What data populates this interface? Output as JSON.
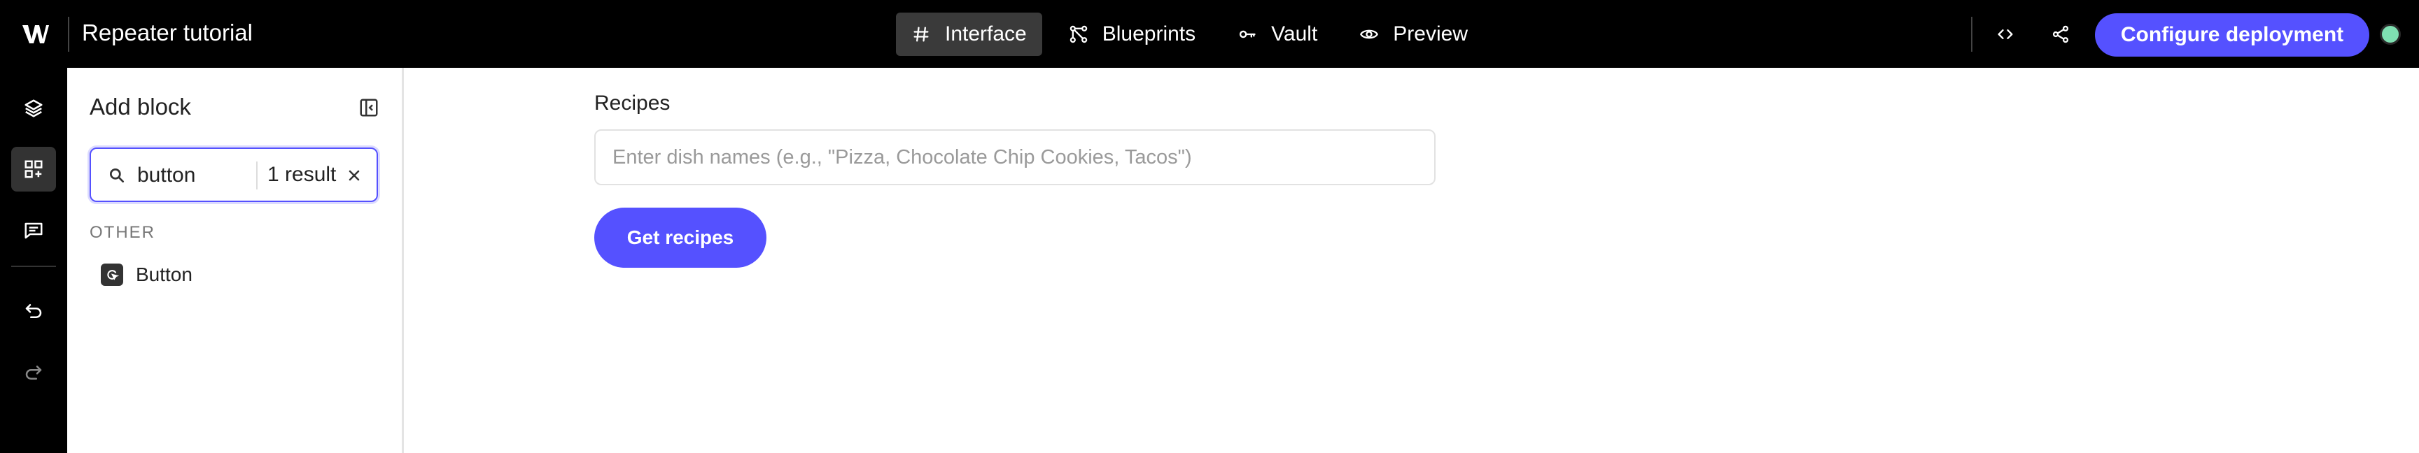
{
  "app": {
    "title": "Repeater tutorial",
    "logo_icon": "w-logo-icon"
  },
  "nav": {
    "tabs": [
      {
        "label": "Interface",
        "icon": "hash-icon",
        "active": true
      },
      {
        "label": "Blueprints",
        "icon": "blueprints-icon",
        "active": false
      },
      {
        "label": "Vault",
        "icon": "key-icon",
        "active": false
      },
      {
        "label": "Preview",
        "icon": "eye-icon",
        "active": false
      }
    ]
  },
  "toolbar": {
    "code_icon": "code-icon",
    "share_icon": "share-icon",
    "deploy_label": "Configure deployment",
    "status_color": "#7fe0b2"
  },
  "rail": {
    "items": [
      "layers-icon",
      "add-block-icon",
      "comment-icon",
      "undo-icon",
      "redo-icon"
    ]
  },
  "panel": {
    "title": "Add block",
    "search": {
      "value": "button",
      "result_count": "1 result"
    },
    "section": "OTHER",
    "blocks": [
      {
        "label": "Button",
        "icon": "button-block-icon"
      }
    ]
  },
  "canvas": {
    "field_label": "Recipes",
    "field_placeholder": "Enter dish names (e.g., \"Pizza, Chocolate Chip Cookies, Tacos\")",
    "button_label": "Get recipes"
  },
  "colors": {
    "accent": "#5551ff",
    "topbar": "#000000"
  }
}
